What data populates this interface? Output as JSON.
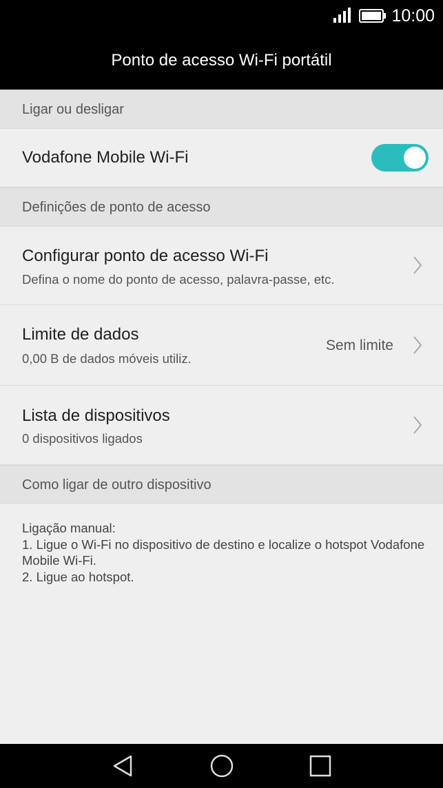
{
  "status_bar": {
    "time": "10:00",
    "icons": [
      "signal-icon",
      "battery-icon"
    ]
  },
  "app_bar": {
    "title": "Ponto de acesso Wi-Fi portátil"
  },
  "sections": {
    "power": {
      "header": "Ligar ou desligar"
    },
    "settings": {
      "header": "Definições de ponto de acesso"
    },
    "connect": {
      "header": "Como ligar de outro dispositivo"
    }
  },
  "hotspot_toggle": {
    "label": "Vodafone Mobile Wi-Fi",
    "state": "on"
  },
  "settings_items": {
    "configure": {
      "title": "Configurar ponto de acesso Wi-Fi",
      "subtitle": "Defina o nome do ponto de acesso, palavra-passe, etc."
    },
    "data_limit": {
      "title": "Limite de dados",
      "subtitle": "0,00 B de dados móveis utiliz.",
      "value": "Sem limite"
    },
    "devices": {
      "title": "Lista de dispositivos",
      "subtitle": "0 dispositivos ligados"
    }
  },
  "instructions": {
    "text": "Ligação manual:\n1. Ligue o Wi-Fi no dispositivo de destino e localize o hotspot Vodafone Mobile Wi-Fi.\n2. Ligue ao hotspot."
  },
  "nav_bar": {
    "buttons": [
      "back-icon",
      "home-icon",
      "recents-icon"
    ]
  },
  "colors": {
    "accent": "#2bbdbd",
    "background": "#efefef",
    "header_background": "#e3e3e3",
    "bars": "#000000"
  }
}
